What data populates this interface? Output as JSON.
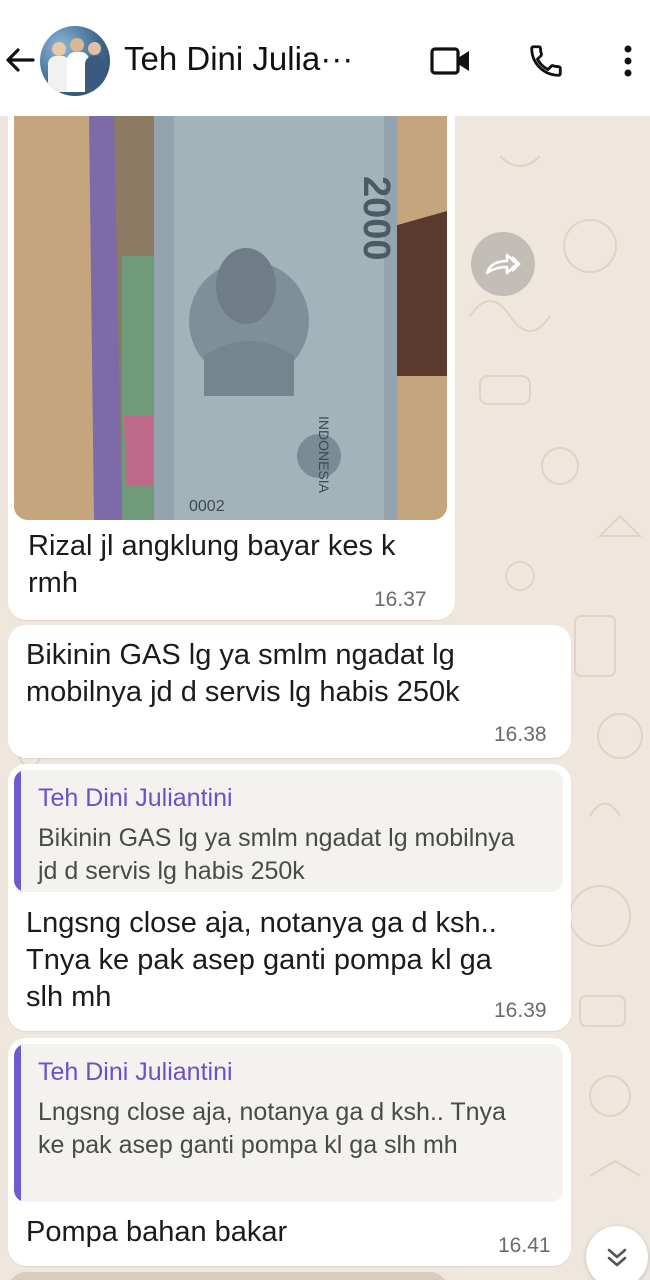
{
  "header": {
    "contact_name": "Teh Dini Julia···",
    "icons": [
      "back-arrow-icon",
      "video-call-icon",
      "voice-call-icon",
      "more-vert-icon"
    ]
  },
  "messages": [
    {
      "type": "image",
      "caption": "Rizal jl angklung bayar kes k rmh",
      "time": "16.37"
    },
    {
      "type": "text",
      "text": "Bikinin GAS lg ya smlm ngadat lg mobilnya jd d servis lg habis 250k",
      "time": "16.38"
    },
    {
      "type": "reply",
      "quoted_name": "Teh Dini Juliantini",
      "quoted_text": "Bikinin GAS lg ya smlm ngadat lg mobilnya jd d servis lg habis 250k",
      "text": "Lngsng close aja, notanya ga d ksh.. Tnya ke pak asep ganti pompa kl ga slh mh",
      "time": "16.39"
    },
    {
      "type": "reply",
      "quoted_name": "Teh Dini Juliantini",
      "quoted_text": "Lngsng close aja, notanya ga d ksh.. Tnya ke pak asep ganti pompa kl ga slh mh",
      "text": "Pompa bahan bakar",
      "time": "16.41"
    }
  ],
  "colors": {
    "quote_accent": "#6d5bd0",
    "quote_name": "#6d4fc9",
    "wallpaper": "#efe7dd"
  }
}
